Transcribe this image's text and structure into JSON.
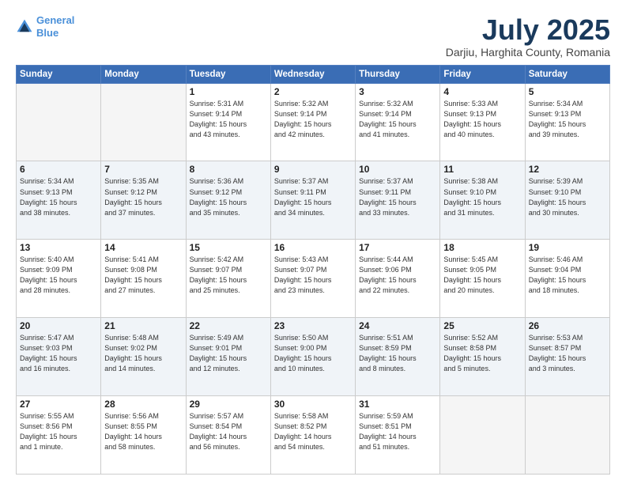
{
  "header": {
    "logo_line1": "General",
    "logo_line2": "Blue",
    "month": "July 2025",
    "location": "Darjiu, Harghita County, Romania"
  },
  "weekdays": [
    "Sunday",
    "Monday",
    "Tuesday",
    "Wednesday",
    "Thursday",
    "Friday",
    "Saturday"
  ],
  "weeks": [
    [
      {
        "day": "",
        "info": ""
      },
      {
        "day": "",
        "info": ""
      },
      {
        "day": "1",
        "info": "Sunrise: 5:31 AM\nSunset: 9:14 PM\nDaylight: 15 hours\nand 43 minutes."
      },
      {
        "day": "2",
        "info": "Sunrise: 5:32 AM\nSunset: 9:14 PM\nDaylight: 15 hours\nand 42 minutes."
      },
      {
        "day": "3",
        "info": "Sunrise: 5:32 AM\nSunset: 9:14 PM\nDaylight: 15 hours\nand 41 minutes."
      },
      {
        "day": "4",
        "info": "Sunrise: 5:33 AM\nSunset: 9:13 PM\nDaylight: 15 hours\nand 40 minutes."
      },
      {
        "day": "5",
        "info": "Sunrise: 5:34 AM\nSunset: 9:13 PM\nDaylight: 15 hours\nand 39 minutes."
      }
    ],
    [
      {
        "day": "6",
        "info": "Sunrise: 5:34 AM\nSunset: 9:13 PM\nDaylight: 15 hours\nand 38 minutes."
      },
      {
        "day": "7",
        "info": "Sunrise: 5:35 AM\nSunset: 9:12 PM\nDaylight: 15 hours\nand 37 minutes."
      },
      {
        "day": "8",
        "info": "Sunrise: 5:36 AM\nSunset: 9:12 PM\nDaylight: 15 hours\nand 35 minutes."
      },
      {
        "day": "9",
        "info": "Sunrise: 5:37 AM\nSunset: 9:11 PM\nDaylight: 15 hours\nand 34 minutes."
      },
      {
        "day": "10",
        "info": "Sunrise: 5:37 AM\nSunset: 9:11 PM\nDaylight: 15 hours\nand 33 minutes."
      },
      {
        "day": "11",
        "info": "Sunrise: 5:38 AM\nSunset: 9:10 PM\nDaylight: 15 hours\nand 31 minutes."
      },
      {
        "day": "12",
        "info": "Sunrise: 5:39 AM\nSunset: 9:10 PM\nDaylight: 15 hours\nand 30 minutes."
      }
    ],
    [
      {
        "day": "13",
        "info": "Sunrise: 5:40 AM\nSunset: 9:09 PM\nDaylight: 15 hours\nand 28 minutes."
      },
      {
        "day": "14",
        "info": "Sunrise: 5:41 AM\nSunset: 9:08 PM\nDaylight: 15 hours\nand 27 minutes."
      },
      {
        "day": "15",
        "info": "Sunrise: 5:42 AM\nSunset: 9:07 PM\nDaylight: 15 hours\nand 25 minutes."
      },
      {
        "day": "16",
        "info": "Sunrise: 5:43 AM\nSunset: 9:07 PM\nDaylight: 15 hours\nand 23 minutes."
      },
      {
        "day": "17",
        "info": "Sunrise: 5:44 AM\nSunset: 9:06 PM\nDaylight: 15 hours\nand 22 minutes."
      },
      {
        "day": "18",
        "info": "Sunrise: 5:45 AM\nSunset: 9:05 PM\nDaylight: 15 hours\nand 20 minutes."
      },
      {
        "day": "19",
        "info": "Sunrise: 5:46 AM\nSunset: 9:04 PM\nDaylight: 15 hours\nand 18 minutes."
      }
    ],
    [
      {
        "day": "20",
        "info": "Sunrise: 5:47 AM\nSunset: 9:03 PM\nDaylight: 15 hours\nand 16 minutes."
      },
      {
        "day": "21",
        "info": "Sunrise: 5:48 AM\nSunset: 9:02 PM\nDaylight: 15 hours\nand 14 minutes."
      },
      {
        "day": "22",
        "info": "Sunrise: 5:49 AM\nSunset: 9:01 PM\nDaylight: 15 hours\nand 12 minutes."
      },
      {
        "day": "23",
        "info": "Sunrise: 5:50 AM\nSunset: 9:00 PM\nDaylight: 15 hours\nand 10 minutes."
      },
      {
        "day": "24",
        "info": "Sunrise: 5:51 AM\nSunset: 8:59 PM\nDaylight: 15 hours\nand 8 minutes."
      },
      {
        "day": "25",
        "info": "Sunrise: 5:52 AM\nSunset: 8:58 PM\nDaylight: 15 hours\nand 5 minutes."
      },
      {
        "day": "26",
        "info": "Sunrise: 5:53 AM\nSunset: 8:57 PM\nDaylight: 15 hours\nand 3 minutes."
      }
    ],
    [
      {
        "day": "27",
        "info": "Sunrise: 5:55 AM\nSunset: 8:56 PM\nDaylight: 15 hours\nand 1 minute."
      },
      {
        "day": "28",
        "info": "Sunrise: 5:56 AM\nSunset: 8:55 PM\nDaylight: 14 hours\nand 58 minutes."
      },
      {
        "day": "29",
        "info": "Sunrise: 5:57 AM\nSunset: 8:54 PM\nDaylight: 14 hours\nand 56 minutes."
      },
      {
        "day": "30",
        "info": "Sunrise: 5:58 AM\nSunset: 8:52 PM\nDaylight: 14 hours\nand 54 minutes."
      },
      {
        "day": "31",
        "info": "Sunrise: 5:59 AM\nSunset: 8:51 PM\nDaylight: 14 hours\nand 51 minutes."
      },
      {
        "day": "",
        "info": ""
      },
      {
        "day": "",
        "info": ""
      }
    ]
  ]
}
